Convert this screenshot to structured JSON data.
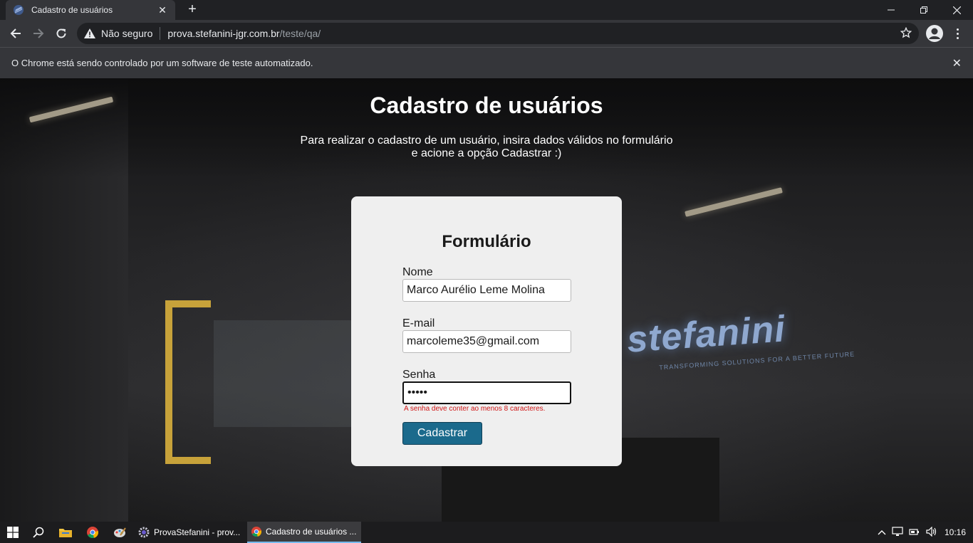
{
  "browser": {
    "tab_title": "Cadastro de usuários",
    "new_tab_symbol": "+",
    "security_label": "Não seguro",
    "url_host": "prova.stefanini-jgr.com.br",
    "url_path": "/teste/qa/",
    "infobar_text": "O Chrome está sendo controlado por um software de teste automatizado.",
    "close_symbol": "✕"
  },
  "page": {
    "title": "Cadastro de usuários",
    "subtitle_line1": "Para realizar o cadastro de um usuário, insira dados válidos no formulário",
    "subtitle_line2": "e acione a opção Cadastrar :)",
    "background_logo": "stefanini",
    "background_logo_sub": "TRANSFORMING SOLUTIONS FOR A BETTER FUTURE"
  },
  "form": {
    "title": "Formulário",
    "name_label": "Nome",
    "name_value": "Marco Aurélio Leme Molina",
    "email_label": "E-mail",
    "email_value": "marcoleme35@gmail.com",
    "password_label": "Senha",
    "password_value": "•••••",
    "password_error": "A senha deve conter ao menos 8 caracteres.",
    "submit_label": "Cadastrar",
    "accent_color": "#1b6a8c",
    "error_color": "#d01616"
  },
  "taskbar": {
    "apps": [
      {
        "label": "ProvaStefanini - prov...",
        "icon": "gear-app-icon"
      },
      {
        "label": "Cadastro de usuários ...",
        "icon": "chrome-icon"
      }
    ],
    "clock": "10:16"
  }
}
